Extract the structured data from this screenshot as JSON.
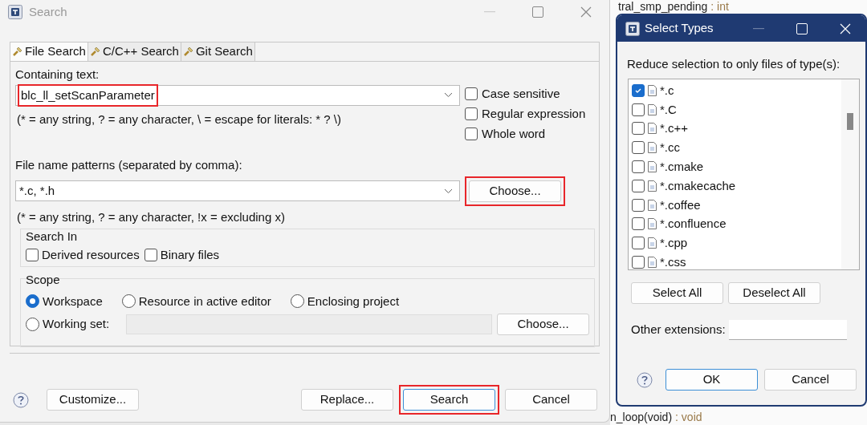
{
  "background_editor": {
    "lines": [
      {
        "name": "tral_smp_pending",
        "type": ": int"
      },
      {
        "name": "n_loop(void)",
        "type": ": void"
      }
    ]
  },
  "search_dialog": {
    "title": "Search",
    "tabs": [
      {
        "label": "File Search",
        "selected": true
      },
      {
        "label": "C/C++ Search",
        "selected": false
      },
      {
        "label": "Git Search",
        "selected": false
      }
    ],
    "containing_text": {
      "label": "Containing text:",
      "value": "blc_ll_setScanParameter",
      "highlighted": true
    },
    "containing_hint": "(* = any string, ? = any character, \\ = escape for literals: * ? \\)",
    "options": [
      {
        "label": "Case sensitive",
        "checked": false
      },
      {
        "label": "Regular expression",
        "checked": false
      },
      {
        "label": "Whole word",
        "checked": false
      }
    ],
    "file_name_patterns": {
      "label": "File name patterns (separated by comma):",
      "value": "*.c, *.h"
    },
    "choose_button": {
      "label": "Choose...",
      "highlighted": true
    },
    "patterns_hint": "(* = any string, ? = any character, !x = excluding x)",
    "search_in": {
      "title": "Search In",
      "options": [
        {
          "label": "Derived resources",
          "checked": false
        },
        {
          "label": "Binary files",
          "checked": false
        }
      ]
    },
    "scope": {
      "title": "Scope",
      "options": [
        {
          "label": "Workspace",
          "selected": true
        },
        {
          "label": "Resource in active editor",
          "selected": false
        },
        {
          "label": "Enclosing project",
          "selected": false
        },
        {
          "label": "Working set:",
          "selected": false
        }
      ],
      "choose_button": "Choose..."
    },
    "left_buttons": [
      {
        "label": "Customize...",
        "highlighted": false
      }
    ],
    "right_buttons": [
      {
        "label": "Replace...",
        "highlighted": false
      },
      {
        "label": "Search",
        "highlighted": true
      },
      {
        "label": "Cancel",
        "highlighted": false
      }
    ]
  },
  "select_types": {
    "title": "Select Types",
    "label": "Reduce selection to only files of type(s):",
    "types": [
      {
        "label": "*.c",
        "checked": true
      },
      {
        "label": "*.C",
        "checked": false
      },
      {
        "label": "*.c++",
        "checked": false
      },
      {
        "label": "*.cc",
        "checked": false
      },
      {
        "label": "*.cmake",
        "checked": false
      },
      {
        "label": "*.cmakecache",
        "checked": false
      },
      {
        "label": "*.coffee",
        "checked": false
      },
      {
        "label": "*.confluence",
        "checked": false
      },
      {
        "label": "*.cpp",
        "checked": false
      },
      {
        "label": "*.css",
        "checked": false
      }
    ],
    "buttons": [
      "Select All",
      "Deselect All"
    ],
    "other_extensions": {
      "label": "Other extensions:"
    },
    "footer_buttons": [
      "OK",
      "Cancel"
    ]
  }
}
